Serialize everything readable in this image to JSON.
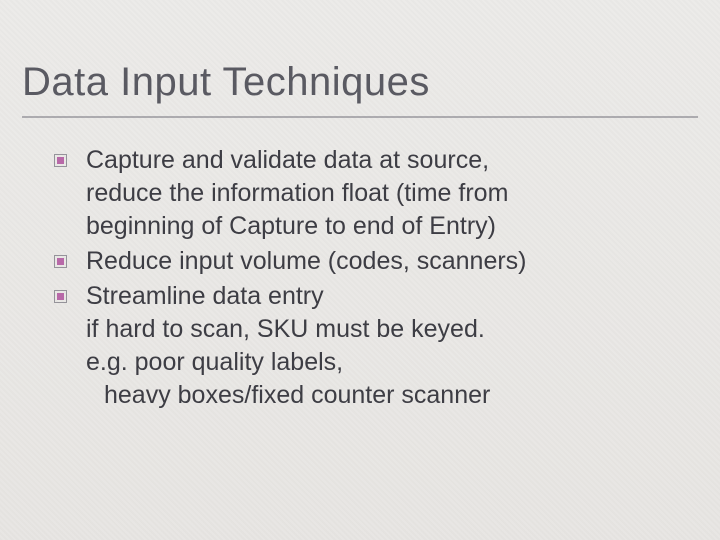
{
  "slide": {
    "title": "Data Input Techniques",
    "bullets": [
      {
        "lines": [
          "Capture and validate data at source,",
          "reduce the information float (time from",
          "beginning of Capture to end of Entry)"
        ]
      },
      {
        "lines": [
          "Reduce input volume (codes, scanners)"
        ]
      },
      {
        "lines": [
          "Streamline data entry",
          "if hard to scan, SKU must be keyed.",
          "e.g. poor quality labels,"
        ],
        "sublines": [
          "heavy boxes/fixed counter scanner"
        ]
      }
    ]
  },
  "colors": {
    "title": "#5a5a62",
    "body": "#3d3d44",
    "bullet_accent": "#b869a8",
    "rule": "#7a7882"
  }
}
